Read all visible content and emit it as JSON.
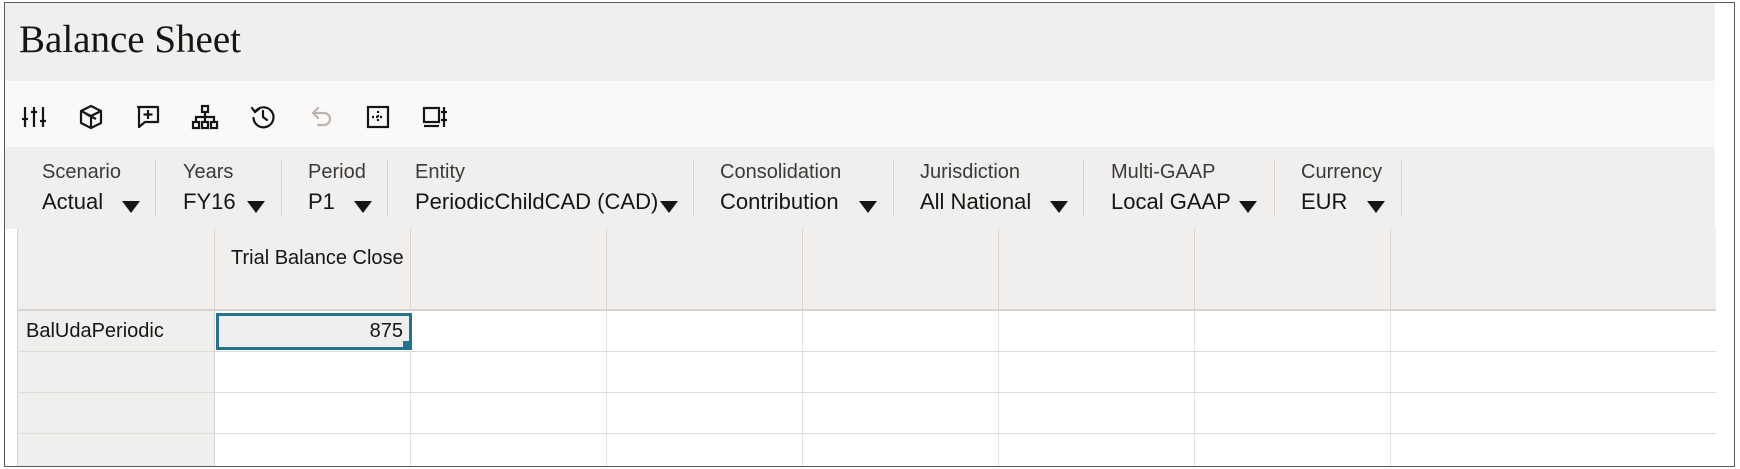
{
  "page": {
    "title": "Balance Sheet"
  },
  "toolbar": {
    "icons": [
      "adjust-icon",
      "cube-icon",
      "add-comment-icon",
      "hierarchy-icon",
      "history-icon",
      "undo-icon",
      "grid-icon",
      "column-options-icon"
    ]
  },
  "pov": [
    {
      "label": "Scenario",
      "value": "Actual"
    },
    {
      "label": "Years",
      "value": "FY16"
    },
    {
      "label": "Period",
      "value": "P1"
    },
    {
      "label": "Entity",
      "value": "PeriodicChildCAD (CAD)"
    },
    {
      "label": "Consolidation",
      "value": "Contribution"
    },
    {
      "label": "Jurisdiction",
      "value": "All National"
    },
    {
      "label": "Multi-GAAP",
      "value": "Local GAAP"
    },
    {
      "label": "Currency",
      "value": "EUR"
    }
  ],
  "grid": {
    "column_headers": [
      "Trial Balance Close",
      "",
      "",
      "",
      "",
      ""
    ],
    "rows": [
      {
        "header": "BalUdaPeriodic",
        "cells": [
          "875",
          "",
          "",
          "",
          "",
          ""
        ]
      },
      {
        "header": "",
        "cells": [
          "",
          "",
          "",
          "",
          "",
          ""
        ]
      },
      {
        "header": "",
        "cells": [
          "",
          "",
          "",
          "",
          "",
          ""
        ]
      },
      {
        "header": "",
        "cells": [
          "",
          "",
          "",
          "",
          "",
          ""
        ]
      }
    ]
  },
  "colors": {
    "accent": "#227290",
    "header_bg": "#f1efed"
  }
}
